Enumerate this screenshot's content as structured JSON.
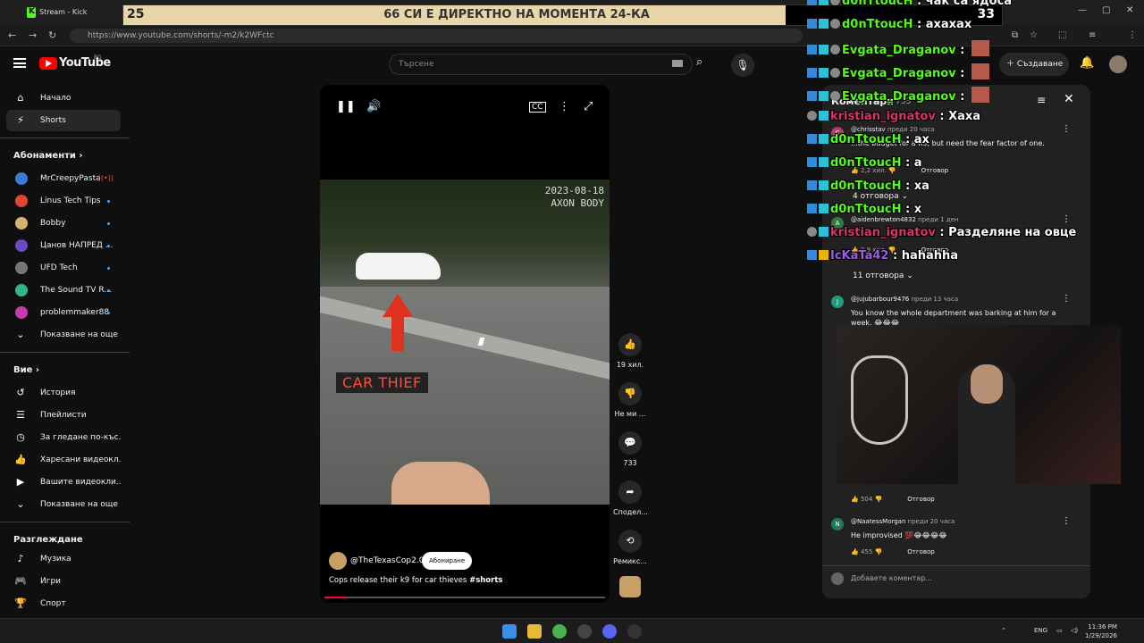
{
  "browser": {
    "tab_title": "Stream - Kick Dashboard",
    "url": "https://www.youtube.com/shorts/-m2/k2WFctc"
  },
  "overlay": {
    "left_number": "25",
    "headline": "66 СИ Е ДИРЕКТНО НА МОМЕНТА 24-КА",
    "right_number": "33"
  },
  "youtube": {
    "logo_text": "YouTube",
    "country": "BG",
    "search_placeholder": "Търсене",
    "create_label": "Създаване"
  },
  "sidebar": {
    "main": [
      {
        "label": "Начало",
        "icon": "home-icon"
      },
      {
        "label": "Shorts",
        "icon": "shorts-icon"
      }
    ],
    "subscriptions_title": "Абонаменти",
    "subscriptions": [
      {
        "label": "MrCreepyPasta",
        "color": "#3a7bd5",
        "badge": "live"
      },
      {
        "label": "Linus Tech Tips",
        "color": "#e0462f",
        "badge": "dot"
      },
      {
        "label": "Bobby",
        "color": "#d9b36b",
        "badge": "dot"
      },
      {
        "label": "Цанов НАПРЕД ...",
        "color": "#6a4bc4",
        "badge": "dot"
      },
      {
        "label": "UFD Tech",
        "color": "#777777",
        "badge": "dot"
      },
      {
        "label": "The Sound TV R...",
        "color": "#2fb58a",
        "badge": "dot"
      },
      {
        "label": "problemmaker88",
        "color": "#c43bb0",
        "badge": "dot"
      }
    ],
    "show_more_1": "Показване на още",
    "you_title": "Вие",
    "you_items": [
      {
        "label": "История",
        "icon": "history-icon"
      },
      {
        "label": "Плейлисти",
        "icon": "playlist-icon"
      },
      {
        "label": "За гледане по-къс...",
        "icon": "watch-later-icon"
      },
      {
        "label": "Харесани видеокл...",
        "icon": "liked-icon"
      },
      {
        "label": "Вашите видеокли...",
        "icon": "your-videos-icon"
      }
    ],
    "show_more_2": "Показване на още",
    "explore_title": "Разглеждане",
    "explore_items": [
      {
        "label": "Музика",
        "icon": "music-icon"
      },
      {
        "label": "Игри",
        "icon": "gaming-icon"
      },
      {
        "label": "Спорт",
        "icon": "sports-icon"
      }
    ]
  },
  "short": {
    "timestamp_line1": "2023-08-18",
    "timestamp_line2": "AXON BODY",
    "overlay_label": "CAR THIEF",
    "channel": "@TheTexasCop2.0",
    "subscribe_label": "Абониране",
    "title": "Cops release their k9 for car thieves",
    "title_tag": "#shorts",
    "progress": 0.08
  },
  "actions": {
    "likes": "19 хил.",
    "dislike": "Не ми ...",
    "comments": "733",
    "share": "Сподел...",
    "remix": "Ремикс..."
  },
  "comments_panel": {
    "title": "Коментари",
    "count": "733",
    "items": [
      {
        "avatar": "C",
        "avatar_color": "#b03a6a",
        "user": "@chrisstav",
        "time": "преди 20 часа",
        "text": "...the budget for a K9, but need the fear factor of one.",
        "likes": "2,2 хил.",
        "reply": "Отговор",
        "replies": "4 отговора"
      },
      {
        "avatar": "A",
        "avatar_color": "#2f7a45",
        "user": "@aidenbrewton4832",
        "time": "преди 1 ден",
        "text": "",
        "likes": "2,9 хил.",
        "reply": "Отговор",
        "replies": "11 отговора"
      },
      {
        "avatar": "J",
        "avatar_color": "#1f9a7c",
        "user": "@jujubarbour9476",
        "time": "преди 13 часа",
        "text": "You know the whole department was barking at him for a week. 😂😂😂",
        "likes": "504",
        "reply": "Отговор",
        "replies": ""
      },
      {
        "avatar": "N",
        "avatar_color": "#1f7a5a",
        "user": "@NaatessMorgan",
        "time": "преди 20 часа",
        "text": "He improvised 💯😂😂😂😂",
        "likes": "455",
        "reply": "Отговор",
        "replies": ""
      }
    ],
    "add_placeholder": "Добавете коментар..."
  },
  "chat": [
    {
      "user": "d0nTtoucH",
      "color": "#53fc18",
      "msg": "чак са ядоса"
    },
    {
      "user": "d0nTtoucH",
      "color": "#53fc18",
      "msg": "ахахах"
    },
    {
      "user": "Evgata_Draganov",
      "color": "#53fc18",
      "msg": "",
      "emote": true
    },
    {
      "user": "Evgata_Draganov",
      "color": "#53fc18",
      "msg": "",
      "emote": true
    },
    {
      "user": "Evgata_Draganov",
      "color": "#53fc18",
      "msg": "",
      "emote": true
    },
    {
      "user": "kristian_ignatov",
      "color": "#e0306a",
      "msg": "Хаха"
    },
    {
      "user": "d0nTtoucH",
      "color": "#53fc18",
      "msg": "ах"
    },
    {
      "user": "d0nTtoucH",
      "color": "#53fc18",
      "msg": "а"
    },
    {
      "user": "d0nTtoucH",
      "color": "#53fc18",
      "msg": "ха"
    },
    {
      "user": "d0nTtoucH",
      "color": "#53fc18",
      "msg": "х"
    },
    {
      "user": "kristian_ignatov",
      "color": "#e0306a",
      "msg": "Разделяне на овце"
    },
    {
      "user": "IcKaTa42",
      "color": "#9b5de5",
      "msg": "hahahha"
    }
  ],
  "taskbar": {
    "lang": "ENG",
    "time": "11:36 PM",
    "date": "1/29/2026"
  }
}
